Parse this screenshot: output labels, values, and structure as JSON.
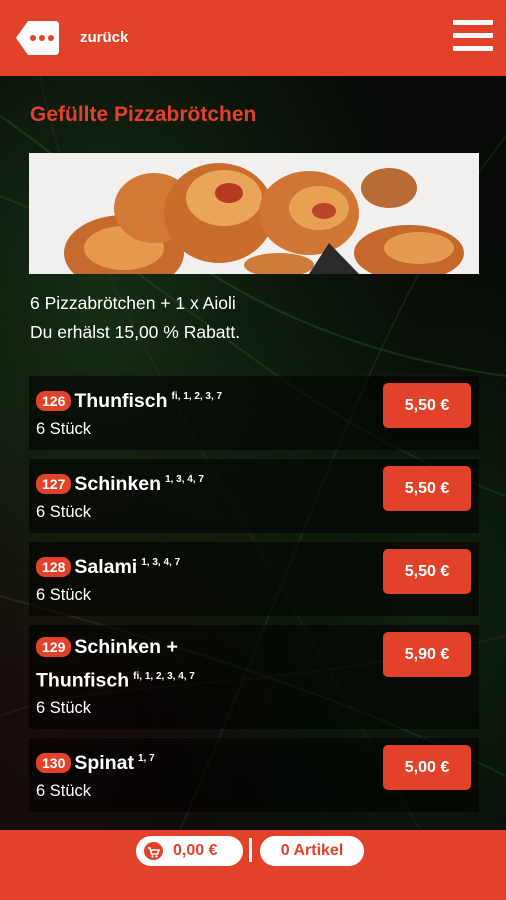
{
  "header": {
    "back_label": "zurück",
    "back_icon": "dots-back-icon",
    "menu_icon": "hamburger-menu-icon"
  },
  "category": {
    "title": "Gefüllte Pizzabrötchen",
    "description_line1": "6 Pizzabrötchen + 1 x Aioli",
    "description_line2": "Du erhälst 15,00 % Rabatt."
  },
  "items": [
    {
      "number": "126",
      "name": "Thunfisch",
      "allergens": "fi, 1, 2, 3, 7",
      "qty": "6 Stück",
      "price": "5,50 €"
    },
    {
      "number": "127",
      "name": "Schinken",
      "allergens": "1, 3, 4, 7",
      "qty": "6 Stück",
      "price": "5,50 €"
    },
    {
      "number": "128",
      "name": "Salami",
      "allergens": "1, 3, 4, 7",
      "qty": "6 Stück",
      "price": "5,50 €"
    },
    {
      "number": "129",
      "name": "Schinken +",
      "name_line2": "Thunfisch",
      "allergens": "fi, 1, 2, 3, 4, 7",
      "qty": "6 Stück",
      "price": "5,90 €"
    },
    {
      "number": "130",
      "name": "Spinat",
      "allergens": "1, 7",
      "qty": "6 Stück",
      "price": "5,00 €"
    }
  ],
  "footer": {
    "cart_total": "0,00 €",
    "cart_icon": "cart-icon",
    "separator": "|",
    "article_count": "0 Artikel"
  },
  "colors": {
    "accent": "#e2412a",
    "background": "#060906",
    "text": "#ffffff"
  }
}
